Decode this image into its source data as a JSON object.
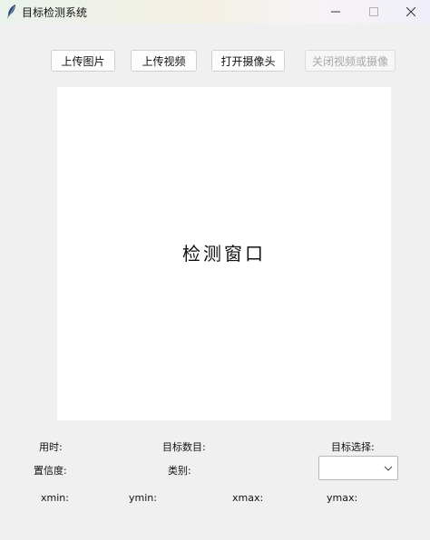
{
  "window": {
    "title": "目标检测系统",
    "icons": {
      "app": "feather-icon",
      "minimize": "minimize-icon",
      "maximize": "maximize-icon",
      "close": "close-icon"
    }
  },
  "toolbar": {
    "upload_image": "上传图片",
    "upload_video": "上传视频",
    "open_camera": "打开摄像头",
    "close_video_camera": "关闭视频或摄像"
  },
  "display": {
    "label": "检测窗口"
  },
  "info": {
    "time_label": "用时:",
    "target_count_label": "目标数目:",
    "target_select_label": "目标选择:",
    "confidence_label": "置信度:",
    "category_label": "类别:",
    "xmin_label": "xmin:",
    "ymin_label": "ymin:",
    "xmax_label": "xmax:",
    "ymax_label": "ymax:"
  },
  "target_select": {
    "value": ""
  },
  "colors": {
    "background": "#f0f0f0",
    "canvas": "#ffffff",
    "disabled_text": "#a8a8a8"
  }
}
